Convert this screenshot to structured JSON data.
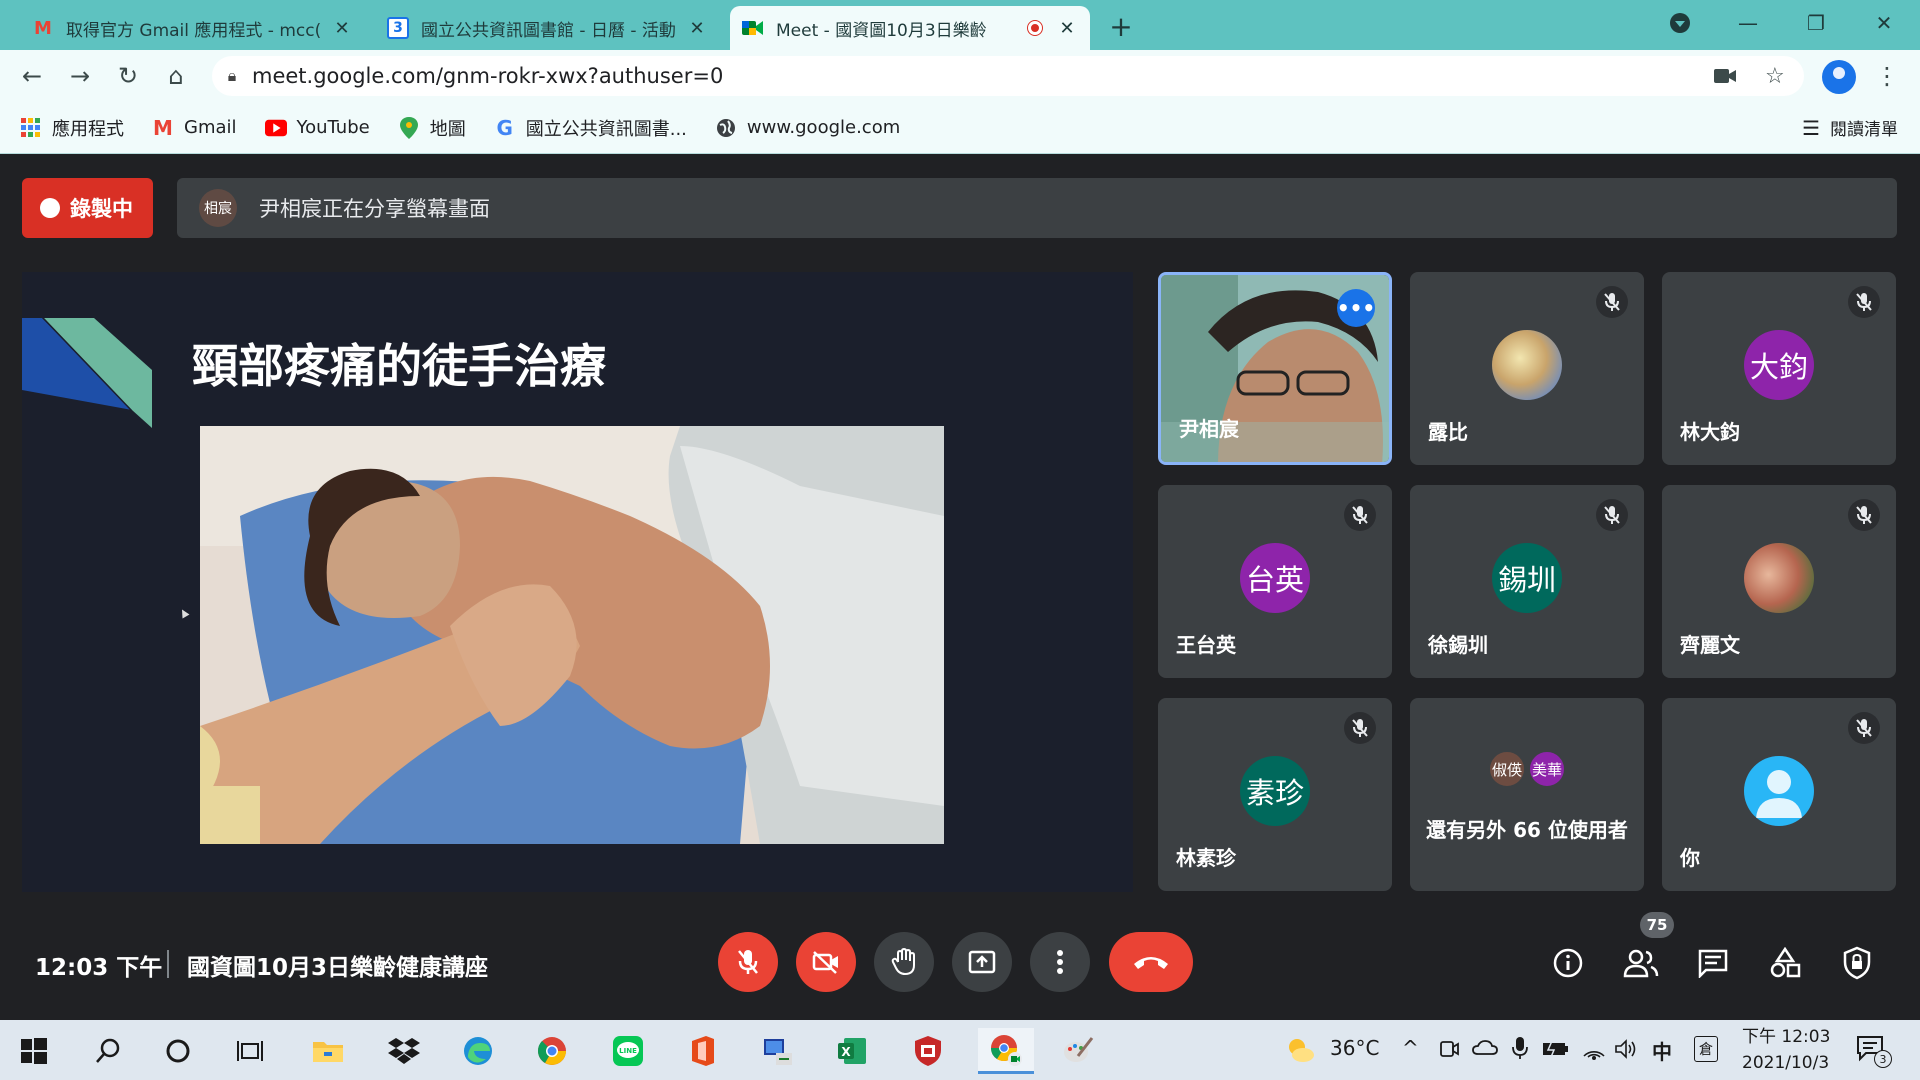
{
  "browser": {
    "tabs": [
      {
        "label": "取得官方 Gmail 應用程式 - mcc(",
        "icon": "gmail-icon"
      },
      {
        "label": "國立公共資訊圖書館 - 日曆 - 活動",
        "icon": "calendar-icon",
        "icon_text": "3"
      },
      {
        "label": "Meet - 國資圖10月3日樂齡",
        "icon": "meet-icon",
        "recording": true
      }
    ],
    "url": "meet.google.com/gnm-rokr-xwx?authuser=0",
    "bookmarks": [
      {
        "label": "應用程式",
        "icon": "apps-grid-icon"
      },
      {
        "label": "Gmail",
        "icon": "gmail-icon",
        "icon_text": "M"
      },
      {
        "label": "YouTube",
        "icon": "youtube-icon"
      },
      {
        "label": "地圖",
        "icon": "maps-icon"
      },
      {
        "label": "國立公共資訊圖書...",
        "icon": "google-icon",
        "icon_text": "G"
      },
      {
        "label": "www.google.com",
        "icon": "globe-icon"
      }
    ],
    "reading_list": "閱讀清單"
  },
  "meet": {
    "recording_label": "錄製中",
    "presenter_initials": "相宸",
    "sharing_text": "尹相宸正在分享螢幕畫面",
    "slide_title": "頸部疼痛的徒手治療",
    "participants": [
      {
        "name": "尹相宸",
        "type": "video",
        "speaking": true
      },
      {
        "name": "露比",
        "type": "photo",
        "avatar_color": "#c9a46b",
        "muted": true
      },
      {
        "name": "林大鈞",
        "initials": "大鈞",
        "avatar_color": "#8e24aa",
        "muted": true
      },
      {
        "name": "王台英",
        "initials": "台英",
        "avatar_color": "#8e24aa",
        "muted": true
      },
      {
        "name": "徐錫圳",
        "initials": "錫圳",
        "avatar_color": "#00695c",
        "muted": true
      },
      {
        "name": "齊麗文",
        "type": "photo",
        "avatar_color": "#b5654f",
        "muted": true
      },
      {
        "name": "林素珍",
        "initials": "素珍",
        "avatar_color": "#00695c",
        "muted": true
      },
      {
        "name": "others",
        "others_text": "還有另外 66 位使用者",
        "chips": [
          {
            "initials": "俶偀",
            "color": "#6d4c41"
          },
          {
            "initials": "美華",
            "color": "#8e24aa"
          }
        ]
      },
      {
        "name": "你",
        "type": "self",
        "avatar_color": "#4fc3f7",
        "muted": true
      }
    ],
    "time": "12:03 下午",
    "meeting_title": "國資圖10月3日樂齡健康講座",
    "participant_count": "75"
  },
  "taskbar": {
    "weather": "36°C",
    "ime": "中",
    "clock_time": "下午 12:03",
    "clock_date": "2021/10/3",
    "notification_count": "3"
  }
}
